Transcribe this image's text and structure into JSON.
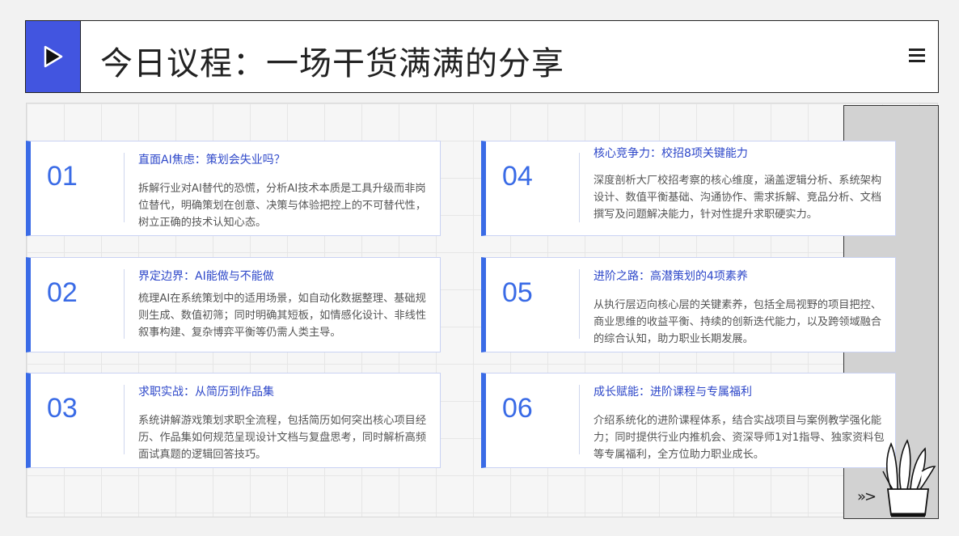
{
  "header": {
    "title": "今日议程：一场干货满满的分享"
  },
  "icons": {
    "play": "play-icon",
    "menu": "menu-icon",
    "arrows": "triple-chevron-right-icon",
    "plant": "plant-pot-illustration"
  },
  "footer": {
    "arrows": "»>"
  },
  "colors": {
    "accent": "#3a6be6",
    "header_block": "#4255e0",
    "title_text": "#2d47c9",
    "side_panel": "#d2d2d2"
  },
  "cards": [
    {
      "num": "01",
      "title": "直面AI焦虑：策划会失业吗？",
      "desc": "拆解行业对AI替代的恐慌，分析AI技术本质是工具升级而非岗位替代，明确策划在创意、决策与体验把控上的不可替代性，树立正确的技术认知心态。"
    },
    {
      "num": "02",
      "title": "界定边界：AI能做与不能做",
      "desc": "梳理AI在系统策划中的适用场景，如自动化数据整理、基础规则生成、数值初筛；同时明确其短板，如情感化设计、非线性叙事构建、复杂博弈平衡等仍需人类主导。"
    },
    {
      "num": "03",
      "title": "求职实战：从简历到作品集",
      "desc": "系统讲解游戏策划求职全流程，包括简历如何突出核心项目经历、作品集如何规范呈现设计文档与复盘思考，同时解析高频面试真题的逻辑回答技巧。"
    },
    {
      "num": "04",
      "title": "核心竞争力：校招8项关键能力",
      "desc": "深度剖析大厂校招考察的核心维度，涵盖逻辑分析、系统架构设计、数值平衡基础、沟通协作、需求拆解、竞品分析、文档撰写及问题解决能力，针对性提升求职硬实力。"
    },
    {
      "num": "05",
      "title": "进阶之路：高潜策划的4项素养",
      "desc": "从执行层迈向核心层的关键素养，包括全局视野的项目把控、商业思维的收益平衡、持续的创新迭代能力，以及跨领域融合的综合认知，助力职业长期发展。"
    },
    {
      "num": "06",
      "title": "成长赋能：进阶课程与专属福利",
      "desc": "介绍系统化的进阶课程体系，结合实战项目与案例教学强化能力；同时提供行业内推机会、资深导师1对1指导、独家资料包等专属福利，全方位助力职业成长。"
    }
  ]
}
